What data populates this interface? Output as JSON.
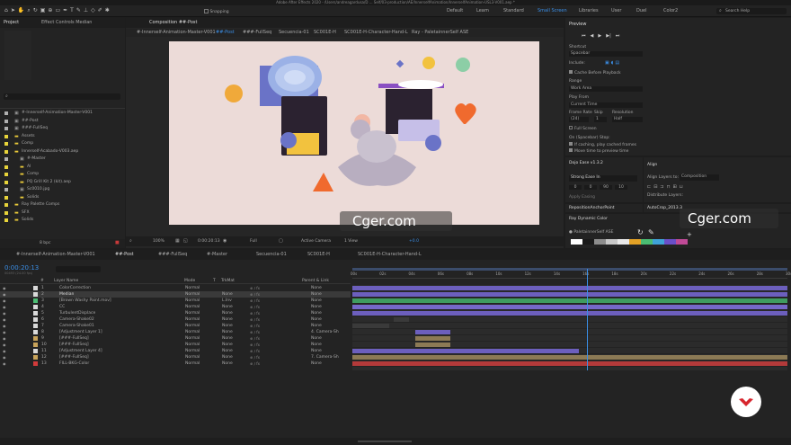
{
  "app": {
    "title": "Adobe After Effects 2020 - /Users/andreagardusa/D ... Self/03-production/AE/InnerselfAnimation/InnerselfAnimation-USL3-V001.aep *"
  },
  "toolbar": {
    "snapping": "Snapping",
    "workspaces": [
      "Default",
      "Learn",
      "Standard",
      "Small Screen",
      "Libraries",
      "User",
      "Duel",
      "Color2"
    ],
    "active_workspace": "Small Screen",
    "search": "Search Help"
  },
  "project": {
    "tab": "Project",
    "effect_tab": "Effect Controls Median",
    "search_placeholder": "",
    "items": [
      {
        "name": "#-Innerself-Animation-Master-V001",
        "color": "#b1b1b1",
        "indent": 0
      },
      {
        "name": "##-Post",
        "color": "#b1b1b1",
        "indent": 0
      },
      {
        "name": "###-FullSeq",
        "color": "#b1b1b1",
        "indent": 0
      },
      {
        "name": "Assets",
        "color": "#e8d43a",
        "indent": 0
      },
      {
        "name": "Comp",
        "color": "#e8d43a",
        "indent": 0
      },
      {
        "name": "Innerself-Acabado-V003.aep",
        "color": "#e8d43a",
        "indent": 0
      },
      {
        "name": "#-Master",
        "color": "#b1b1b1",
        "indent": 1
      },
      {
        "name": "AI",
        "color": "#e8d43a",
        "indent": 1
      },
      {
        "name": "Comp",
        "color": "#e8d43a",
        "indent": 1
      },
      {
        "name": "PQ Grill Kit 2 (kit).aep",
        "color": "#e8d43a",
        "indent": 1
      },
      {
        "name": "Sc0010.jpg",
        "color": "#b1b1b1",
        "indent": 1
      },
      {
        "name": "Solids",
        "color": "#e8d43a",
        "indent": 1
      },
      {
        "name": "Ray Palette Comps",
        "color": "#e8d43a",
        "indent": 0
      },
      {
        "name": "SFX",
        "color": "#e8d43a",
        "indent": 0
      },
      {
        "name": "Solids",
        "color": "#e8d43a",
        "indent": 0
      }
    ],
    "bpc": "8 bpc"
  },
  "composition": {
    "tab": "Composition ##-Post",
    "subtabs": [
      "#-Innerself-Animation-Master-V001",
      "##-Post",
      "###-FullSeq",
      "Secuencia-01",
      "SC001E-H",
      "SC001E-H-Character-Hand-L",
      "Ray - PaletainnerSelf ASE"
    ],
    "active_subtab": "##-Post",
    "zoom": "100%",
    "timecode": "0:00:20:13",
    "resolution": "Full",
    "camera": "Active Camera",
    "views": "1 View",
    "exposure": "+0.0"
  },
  "preview": {
    "title": "Preview",
    "shortcut_label": "Shortcut",
    "shortcut": "Spacebar",
    "include": "Include:",
    "cache": "Cache Before Playback",
    "range_label": "Range",
    "range": "Work Area",
    "play_from_label": "Play From",
    "play_from": "Current Time",
    "frame_rate_label": "Frame Rate",
    "skip_label": "Skip",
    "resolution_label": "Resolution",
    "frame_rate": "(24)",
    "skip": "1",
    "resolution": "Half",
    "full_screen": "Full Screen",
    "stop_label": "On (Spacebar) Stop:",
    "if_caching": "If caching, play cached frames",
    "move_time": "Move time to preview time"
  },
  "dojo": {
    "title": "Dojo Ease v1.3.2",
    "ease": "Strong Ease In",
    "fields": [
      "0",
      "0",
      "90",
      "10"
    ],
    "apply": "Apply Easing"
  },
  "align": {
    "title": "Align",
    "align_to_label": "Align Layers to:",
    "align_to": "Composition",
    "distribute": "Distribute Layers:"
  },
  "reposition": {
    "title": "RepositionAnchorPoint"
  },
  "autocrop": {
    "title": "AutoCrop_2013.3"
  },
  "ray": {
    "title": "Ray Dynamic Color",
    "palette": "PaletainnerSelf ASE",
    "colors": [
      "#ffffff",
      "#1a1a1a",
      "#8d8d8d",
      "#c8c8c8",
      "#e9e9e9",
      "#e3a126",
      "#4bbd73",
      "#3fa3d8",
      "#6a4fc8",
      "#c04a97"
    ]
  },
  "timeline": {
    "tabs": [
      "#-Innerself-Animation-Master-V001",
      "##-Post",
      "###-FullSeq",
      "#-Master",
      "Secuencia-01",
      "SC001E-H",
      "SC001E-H-Character-Hand-L"
    ],
    "active_tab": "##-Post",
    "timecode": "0:00:20:13",
    "frame_info": "00493 (24.00 fps)",
    "headers": {
      "num": "#",
      "name": "Layer Name",
      "mode": "Mode",
      "t": "T",
      "trkmat": "TrkMat",
      "parent": "Parent & Link"
    },
    "ruler": [
      "00s",
      "02s",
      "04s",
      "06s",
      "08s",
      "10s",
      "12s",
      "14s",
      "16s",
      "18s",
      "20s",
      "22s",
      "24s",
      "26s",
      "28s",
      "30s"
    ],
    "layers": [
      {
        "num": "1",
        "name": "ColorCorrection",
        "color": "#d9d9d9",
        "mode": "Normal",
        "trk": "",
        "parent": "None",
        "bar_color": "#6c5fbd",
        "start": 0,
        "end": 1
      },
      {
        "num": "2",
        "name": "Median",
        "color": "#d9d9d9",
        "mode": "Normal",
        "trk": "None",
        "parent": "None",
        "bar_color": "#6c5fbd",
        "start": 0,
        "end": 1,
        "selected": true
      },
      {
        "num": "3",
        "name": "[Brown Washy Paint.mov]",
        "color": "#4bbd73",
        "mode": "Normal",
        "trk": "L.Inv",
        "parent": "None",
        "bar_color": "#3f9c60",
        "start": 0,
        "end": 1
      },
      {
        "num": "4",
        "name": "CC",
        "color": "#d9d9d9",
        "mode": "Normal",
        "trk": "None",
        "parent": "None",
        "bar_color": "#7668c9",
        "start": 0,
        "end": 1
      },
      {
        "num": "5",
        "name": "TurbulentDisplace",
        "color": "#d9d9d9",
        "mode": "Normal",
        "trk": "None",
        "parent": "None",
        "bar_color": "#6c5fbd",
        "start": 0,
        "end": 1
      },
      {
        "num": "6",
        "name": "Camera-Shake02",
        "color": "#d9d9d9",
        "mode": "Normal",
        "trk": "None",
        "parent": "None",
        "bar_color": "#3a3a3a",
        "start": 0.095,
        "end": 0.13
      },
      {
        "num": "7",
        "name": "Camera-Shake01",
        "color": "#d9d9d9",
        "mode": "Normal",
        "trk": "None",
        "parent": "None",
        "bar_color": "#3a3a3a",
        "start": 0.0,
        "end": 0.085
      },
      {
        "num": "8",
        "name": "[Adjustment Layer 1]",
        "color": "#d9d9d9",
        "mode": "Normal",
        "trk": "None",
        "parent": "4. Camera-Sh",
        "bar_color": "#6c5fbd",
        "start": 0.145,
        "end": 0.225
      },
      {
        "num": "9",
        "name": "[###-FullSeq]",
        "color": "#c8a35a",
        "mode": "Normal",
        "trk": "None",
        "parent": "None",
        "bar_color": "#8c7a55",
        "start": 0.145,
        "end": 0.225
      },
      {
        "num": "10",
        "name": "[###-FullSeq]",
        "color": "#c8a35a",
        "mode": "Normal",
        "trk": "None",
        "parent": "None",
        "bar_color": "#8c7a55",
        "start": 0.145,
        "end": 0.225
      },
      {
        "num": "11",
        "name": "[Adjustment Layer 4]",
        "color": "#d9d9d9",
        "mode": "Normal",
        "trk": "None",
        "parent": "None",
        "bar_color": "#6c5fbd",
        "start": 0,
        "end": 0.52
      },
      {
        "num": "12",
        "name": "[###-FullSeq]",
        "color": "#c8a35a",
        "mode": "Normal",
        "trk": "None",
        "parent": "7. Camera-Sh",
        "bar_color": "#8c7a55",
        "start": 0,
        "end": 1
      },
      {
        "num": "13",
        "name": "FILL-BKG-Color",
        "color": "#d23b3b",
        "mode": "Normal",
        "trk": "None",
        "parent": "None",
        "bar_color": "#b33a3a",
        "start": 0,
        "end": 1
      }
    ],
    "playhead": 0.54
  },
  "watermark": {
    "text1": "Cger.com",
    "text2": "Cger.com"
  }
}
